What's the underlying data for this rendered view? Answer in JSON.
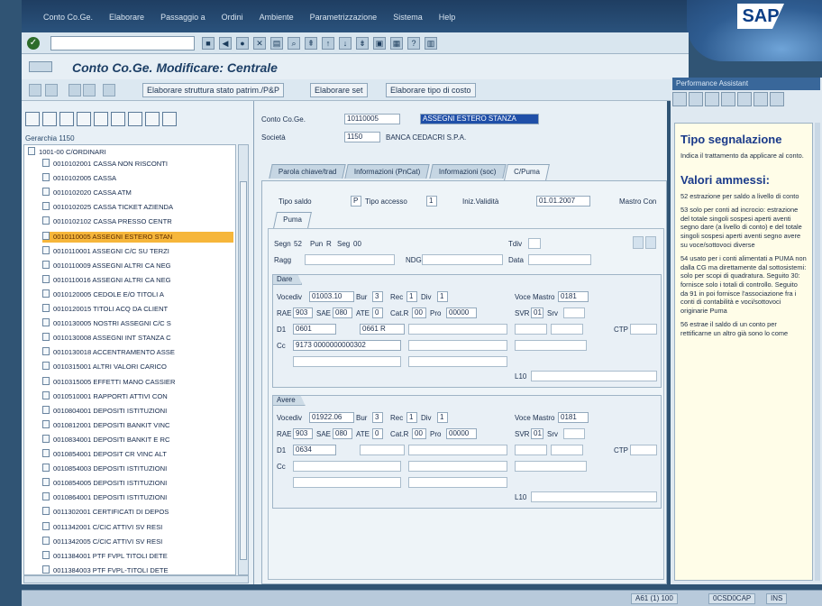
{
  "menubar": {
    "items": [
      "Conto Co.Ge.",
      "Elaborare",
      "Passaggio a",
      "Ordini",
      "Ambiente",
      "Parametrizzazione",
      "Sistema",
      "Help"
    ]
  },
  "brand": {
    "logo": "SAP"
  },
  "colors": {
    "accent": "#1f4fa8",
    "selection": "#f6b63a",
    "help_title": "#1a3a8a"
  },
  "title": "Conto Co.Ge. Modificare: Centrale",
  "app_toolbar": {
    "buttons": [
      "Elaborare struttura stato patrim./P&P",
      "Elaborare set",
      "Elaborare tipo di costo"
    ]
  },
  "tree": {
    "header": "Gerarchia 1150",
    "root": "1001-00 C/ORDINARI",
    "items": [
      "0010102001 CASSA NON RISCONTI",
      "0010102005 CASSA",
      "0010102020 CASSA ATM",
      "0010102025 CASSA TICKET AZIENDA",
      "0010102102 CASSA PRESSO CENTR",
      "0010110005 ASSEGNI ESTERO STAN",
      "0010110001 ASSEGNI C/C SU TERZI",
      "0010110009 ASSEGNI ALTRI CA NEG",
      "0010110016 ASSEGNI ALTRI CA NEG",
      "0010120005 CEDOLE E/O TITOLI A",
      "0010120015 TITOLI ACQ DA CLIENT",
      "0010130005 NOSTRI ASSEGNI C/C S",
      "0010130008 ASSEGNI INT STANZA C",
      "0010130018 ACCENTRAMENTO ASSE",
      "0010315001 ALTRI VALORI CARICO",
      "0010315005 EFFETTI MANO CASSIER",
      "0010510001 RAPPORTI ATTIVI CON",
      "0010804001 DEPOSITI ISTITUZIONI",
      "0010812001 DEPOSITI BANKIT VINC",
      "0010834001 DEPOSITI BANKIT E RC",
      "0010854001 DEPOSIT CR VINC ALT",
      "0010854003 DEPOSITI ISTITUZIONI",
      "0010854005 DEPOSITI ISTITUZIONI",
      "0010864001 DEPOSITI ISTITUZIONI",
      "0011302001 CERTIFICATI DI DEPOS",
      "0011342001 C/CIC ATTIVI SV RESI",
      "0011342005 C/CIC ATTIVI SV RESI",
      "0011384001 PTF FVPL TITOLI DETE",
      "0011384003 PTF FVPL-TITOLI DETE"
    ],
    "selected_index": 5
  },
  "form": {
    "conto_label": "Conto Co.Ge.",
    "conto_value": "10110005",
    "conto_desc": "ASSEGNI ESTERO STANZA",
    "societa_label": "Società",
    "societa_value": "1150",
    "societa_desc": "BANCA CEDACRI S.P.A.",
    "tabs": [
      "Parola chiave/trad",
      "Informazioni (PnCat)",
      "Informazioni (soc)",
      "C/Puma"
    ],
    "tipo_saldo_label": "Tipo saldo",
    "tipo_saldo_value": "P",
    "tipo_accesso_label": "Tipo accesso",
    "tipo_accesso_value": "1",
    "inizio_label": "Iniz.Validità",
    "inizio_value": "01.01.2007",
    "mastro_label": "Mastro Con",
    "puma_tab": "Puma",
    "segn_label": "Segn",
    "segn_value": "52",
    "pun_label": "Pun",
    "pun_value": "R",
    "seg_label": "Seg",
    "seg_value": "00",
    "tdiv_label": "Tdiv",
    "ragg_label": "Ragg",
    "nds_label": "NDG",
    "data_label": "Data",
    "dare": {
      "title": "Dare",
      "vocediv_label": "Vocediv",
      "vocediv_value": "01003.10",
      "bur_label": "Bur",
      "bur_value": "3",
      "rec_label": "Rec",
      "rec_value": "1",
      "div_label": "Div",
      "div_value": "1",
      "voce_mastro_label": "Voce Mastro",
      "voce_mastro_value": "0181",
      "rae_label": "RAE",
      "rae_value": "903",
      "sae_label": "SAE",
      "sae_value": "080",
      "ate_label": "ATE",
      "ate_value": "0",
      "catr_label": "Cat.R",
      "catr_value": "00",
      "pro_label": "Pro",
      "pro_value": "00000",
      "svr_label": "SVR",
      "svr_value": "01",
      "srv_label": "Srv",
      "d1_label": "D1",
      "d1_value": "0601",
      "d1_extra": "0661 R",
      "ctp_label": "CTP",
      "cc_label": "Cc",
      "cc_value": "9173 0000000000302",
      "l10_label": "L10"
    },
    "avere": {
      "title": "Avere",
      "vocediv_label": "Vocediv",
      "vocediv_value": "01922.06",
      "bur_label": "Bur",
      "bur_value": "3",
      "rec_label": "Rec",
      "rec_value": "1",
      "div_label": "Div",
      "div_value": "1",
      "voce_mastro_label": "Voce Mastro",
      "voce_mastro_value": "0181",
      "rae_label": "RAE",
      "rae_value": "903",
      "sae_label": "SAE",
      "sae_value": "080",
      "ate_label": "ATE",
      "ate_value": "0",
      "catr_label": "Cat.R",
      "catr_value": "00",
      "pro_label": "Pro",
      "pro_value": "00000",
      "svr_label": "SVR",
      "svr_value": "01",
      "srv_label": "Srv",
      "d1_label": "D1",
      "d1_value": "0634",
      "ctp_label": "CTP",
      "cc_label": "Cc",
      "l10_label": "L10"
    }
  },
  "help": {
    "header": "Performance Assistant",
    "title1": "Tipo segnalazione",
    "p1": "Indica il trattamento da applicare al conto.",
    "title2": "Valori ammessi:",
    "p2": "52 estrazione per saldo a livello di conto",
    "p3": "53 solo per conti ad incrocio: estrazione del totale singoli sospesi aperti aventi segno dare (a livello di conto) e del totale singoli sospesi aperti aventi segno avere su voce/sottovoci diverse",
    "p4": "54 usato per i conti alimentati a PUMA non dalla CG ma direttamente dal sottosistemi: solo per scopi di quadratura. Seguito 30: fornisce solo i totali di controllo. Seguito da 91 in poi fornisce l'associazione fra i conti di contabilità e voci/sottovoci originarie Puma",
    "p5": "56 estrae il saldo di un conto per rettificarne un altro già sono lo come"
  },
  "status": {
    "system": "A61 (1) 100",
    "user": "0CSD0CAP",
    "mode": "INS"
  }
}
